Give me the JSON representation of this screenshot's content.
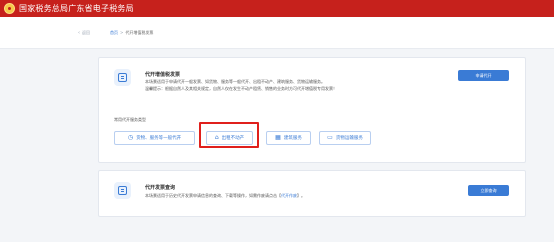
{
  "header": {
    "site_title": "国家税务总局广东省电子税务局"
  },
  "nav": {
    "back_label": "返回",
    "back_icon": "arrow-left-icon",
    "breadcrumb": {
      "home": "首页",
      "separator": ">",
      "current": "代开增值税发票"
    }
  },
  "card_vat": {
    "title": "代开增值税发票",
    "desc_line1": "本场景适用于申请代开一般发票、如货物、服务等一般代开、出租不动产、建筑服务、货物运输服务。",
    "desc_line2": "温馨提示：根据自然人及其相关规定，自然人仅在发生不动产租赁、销售的业务时方可代开增值税专用发票！",
    "apply_button": "申请代开",
    "section_label": "常用代开服务类型",
    "service_types": [
      {
        "label": "货物、服务等一般代开",
        "icon": "clock-icon"
      },
      {
        "label": "出租不动产",
        "icon": "house-icon"
      },
      {
        "label": "建筑服务",
        "icon": "building-icon"
      },
      {
        "label": "货物运输服务",
        "icon": "truck-icon"
      }
    ]
  },
  "card_query": {
    "title": "代开发票查询",
    "desc_prefix": "本场景适用于历史代开发票申请信息的查询、下载等操作，如需作废请点击【",
    "desc_link": "代开作废",
    "desc_suffix": "】。",
    "enter_button": "立即查询"
  },
  "colors": {
    "brand_red": "#c6211c",
    "primary_blue": "#3a7bd5",
    "highlight_red": "#e0201c"
  }
}
